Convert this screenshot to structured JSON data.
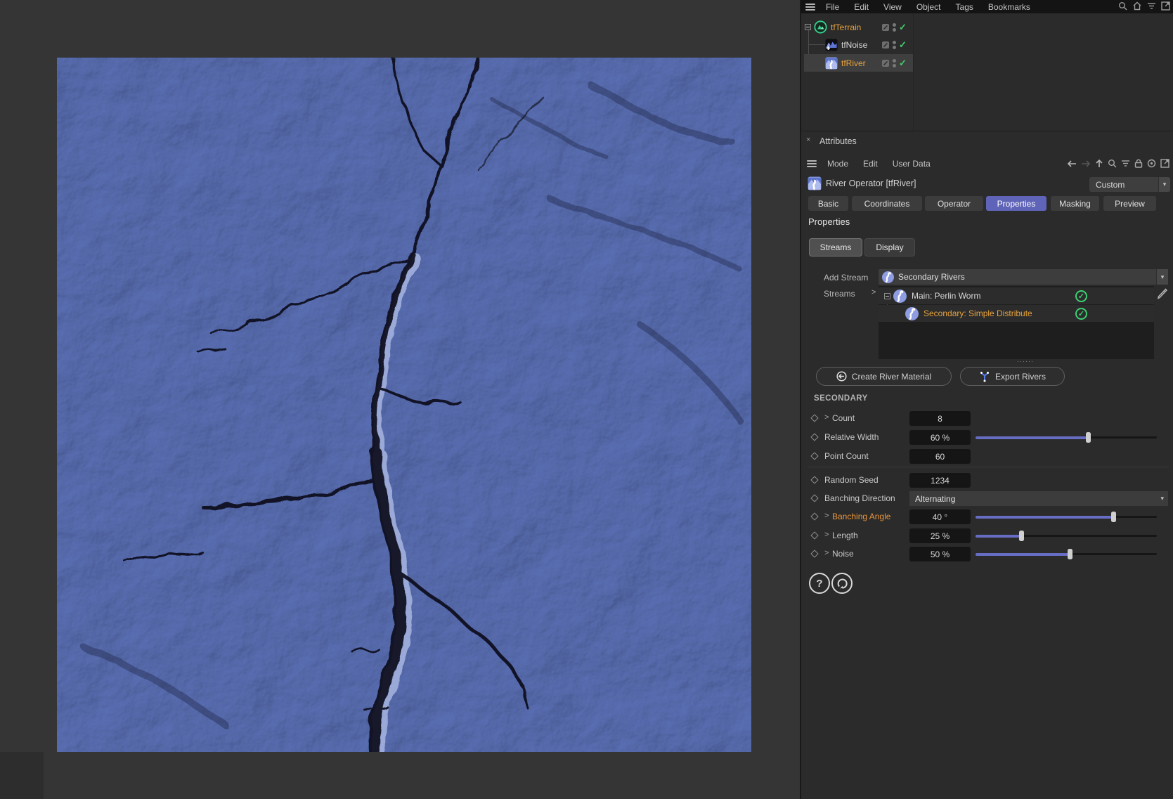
{
  "menu_bar": {
    "items": [
      "File",
      "Edit",
      "View",
      "Object",
      "Tags",
      "Bookmarks"
    ]
  },
  "object_manager": {
    "rows": [
      {
        "label": "tfTerrain"
      },
      {
        "label": "tfNoise"
      },
      {
        "label": "tfRiver"
      }
    ]
  },
  "attributes": {
    "title": "Attributes",
    "close_glyph": "×",
    "menu_items": [
      "Mode",
      "Edit",
      "User Data"
    ],
    "object_title": "River Operator [tfRiver]",
    "preset": "Custom",
    "tabs": [
      "Basic",
      "Coordinates",
      "Operator",
      "Properties",
      "Masking",
      "Preview"
    ],
    "active_tab": "Properties",
    "section": "Properties",
    "subtabs": [
      "Streams",
      "Display"
    ],
    "add_stream_label": "Add Stream",
    "add_stream_value": "Secondary Rivers",
    "streams_label": "Streams",
    "streams_chevron": ">",
    "tree": [
      {
        "label": "Main: Perlin Worm"
      },
      {
        "label": "Secondary: Simple Distribute"
      }
    ],
    "create_material_button": "Create River Material",
    "export_rivers_button": "Export Rivers",
    "group_header": "SECONDARY",
    "params": [
      {
        "label": "Count",
        "value": "8"
      },
      {
        "label": "Relative Width",
        "value": "60 %",
        "slider": 0.62
      },
      {
        "label": "Point Count",
        "value": "60"
      },
      {
        "label": "Random Seed",
        "value": "1234"
      },
      {
        "label": "Banching Direction",
        "value": "Alternating"
      },
      {
        "label": "Banching Angle",
        "value": "40 °",
        "slider": 0.76
      },
      {
        "label": "Length",
        "value": "25 %",
        "slider": 0.25
      },
      {
        "label": "Noise",
        "value": "50 %",
        "slider": 0.52
      }
    ],
    "help_glyph": "?",
    "resize_dots": "······"
  },
  "colors": {
    "accent": "#5f64b8",
    "selection_orange": "#e8a33d",
    "check_green": "#3ecf73",
    "slider_fill": "#686dc4"
  }
}
